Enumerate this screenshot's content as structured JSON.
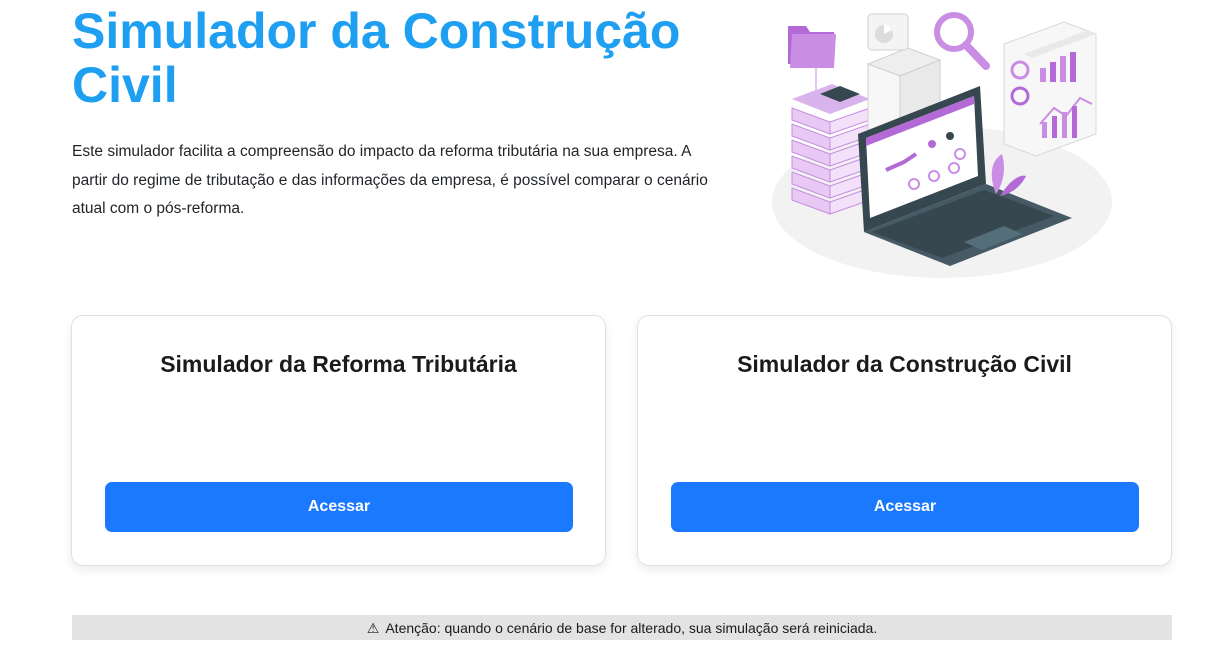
{
  "hero": {
    "title": "Simulador da Construção Civil",
    "description": "Este simulador facilita a compreensão do impacto da reforma tributária na sua empresa. A partir do regime de tributação e das informações da empresa, é possível comparar o cenário atual com o pós-reforma."
  },
  "cards": [
    {
      "title": "Simulador da Reforma Tributária",
      "button_label": "Acessar"
    },
    {
      "title": "Simulador da Construção Civil",
      "button_label": "Acessar"
    }
  ],
  "warning": {
    "icon": "warning-icon",
    "text": "Atenção: quando o cenário de base for alterado, sua simulação será reiniciada."
  },
  "colors": {
    "title": "#1e9ff2",
    "button": "#1a79ff",
    "accent_purple": "#b46ad6",
    "warning_bg": "#e3e3e3"
  }
}
